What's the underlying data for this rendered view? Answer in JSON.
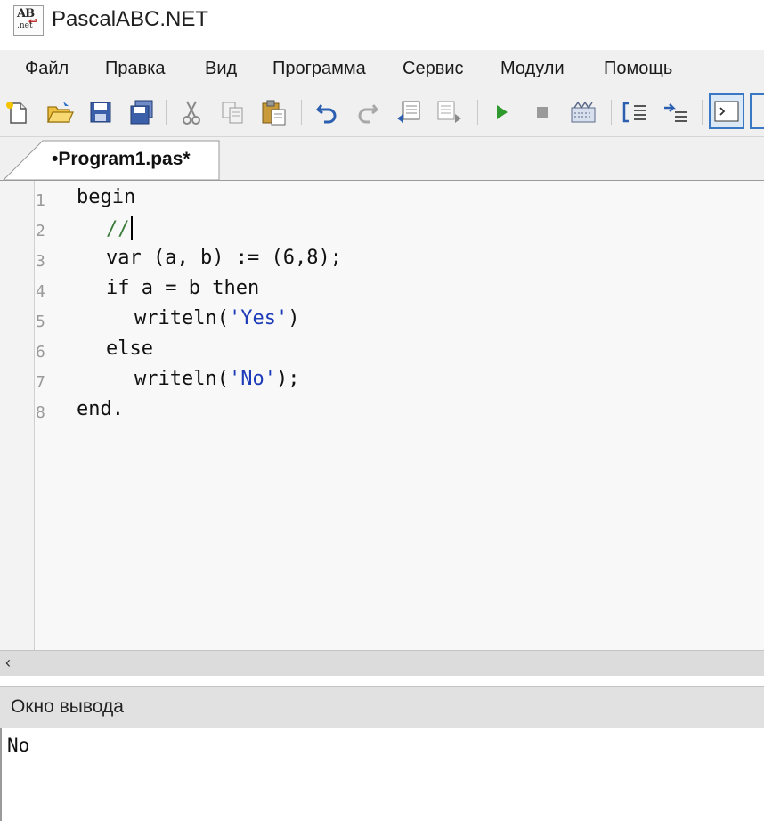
{
  "window": {
    "title": "PascalABC.NET",
    "icon_text": "AB",
    "icon_subtext": ".net"
  },
  "menu": [
    "Файл",
    "Правка",
    "Вид",
    "Программа",
    "Сервис",
    "Модули",
    "Помощь"
  ],
  "toolbar": {
    "icons": [
      "new-file-icon",
      "open-folder-icon",
      "save-icon",
      "save-all-icon",
      "cut-icon",
      "copy-icon",
      "paste-icon",
      "undo-icon",
      "redo-icon",
      "format-code-icon",
      "format-code-alt-icon",
      "run-icon",
      "stop-icon",
      "compile-icon",
      "step-into-icon",
      "step-over-icon",
      "toggle-output-icon"
    ]
  },
  "tab": {
    "label": "•Program1.pas*"
  },
  "editor": {
    "line_numbers": [
      "1",
      "2",
      "3",
      "4",
      "5",
      "6",
      "7",
      "8"
    ],
    "lines": [
      "begin",
      "  //",
      "  var (a, b) := (6,8);",
      "  if a = b then",
      "    writeln('Yes')",
      "  else",
      "    writeln('No');",
      "end."
    ],
    "tokens": {
      "l1_begin": "begin",
      "l2_comment": "//",
      "l3_var": "var",
      "l3_mid": " (a, b) := (",
      "l3_n1": "6",
      "l3_comma": ",",
      "l3_n2": "8",
      "l3_end": ");",
      "l4_if": "if",
      "l4_mid": " a = b ",
      "l4_then": "then",
      "l5_fn": "writeln(",
      "l5_str": "'Yes'",
      "l5_end": ")",
      "l6_else": "else",
      "l7_fn": "writeln(",
      "l7_str": "'No'",
      "l7_end": ");",
      "l8_end": "end."
    }
  },
  "scrollbar": {
    "left_arrow": "‹"
  },
  "output": {
    "title": "Окно вывода",
    "text": "No"
  },
  "colors": {
    "string": "#1d3bb8",
    "comment": "#3c7d3c",
    "run_green": "#2e9a2e",
    "accent": "#3a78c4"
  }
}
